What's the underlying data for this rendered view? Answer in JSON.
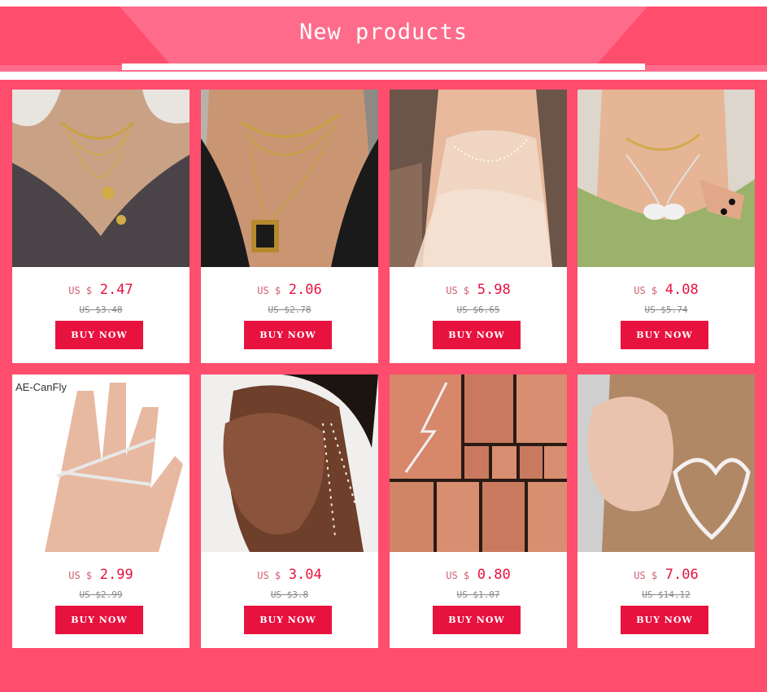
{
  "header": {
    "title": "New products"
  },
  "colors": {
    "accent": "#e8123f",
    "banner": "#ff6b8a",
    "background": "#ff4d6d"
  },
  "products": [
    {
      "currency": "US $",
      "price": "2.47",
      "old_price": "US $3.48",
      "buy_label": "BUY NOW",
      "image": "choker-necklace-photo"
    },
    {
      "currency": "US $",
      "price": "2.06",
      "old_price": "US $2.78",
      "buy_label": "BUY NOW",
      "image": "pendant-necklace-photo"
    },
    {
      "currency": "US $",
      "price": "5.98",
      "old_price": "US $6.65",
      "buy_label": "BUY NOW",
      "image": "pearl-chain-photo"
    },
    {
      "currency": "US $",
      "price": "4.08",
      "old_price": "US $5.74",
      "buy_label": "BUY NOW",
      "image": "butterfly-necklace-photo"
    },
    {
      "currency": "US $",
      "price": "2.99",
      "old_price": "US $2.99",
      "buy_label": "BUY NOW",
      "image": "finger-ring-photo",
      "watermark": "AE-CanFly"
    },
    {
      "currency": "US $",
      "price": "3.04",
      "old_price": "US $3.8",
      "buy_label": "BUY NOW",
      "image": "pearl-earring-photo"
    },
    {
      "currency": "US $",
      "price": "0.80",
      "old_price": "US $1.07",
      "buy_label": "BUY NOW",
      "image": "ear-climber-photo"
    },
    {
      "currency": "US $",
      "price": "7.06",
      "old_price": "US $14.12",
      "buy_label": "BUY NOW",
      "image": "heart-earring-photo"
    }
  ]
}
